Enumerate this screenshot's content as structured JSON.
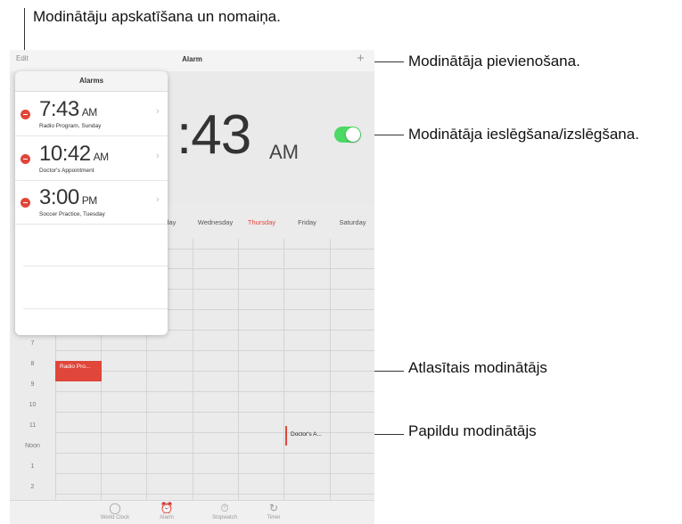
{
  "callouts": {
    "top": "Modinātāju apskatīšana un nomaiņa.",
    "add": "Modinātāja pievienošana.",
    "toggle": "Modinātāja ieslēgšana/izslēgšana.",
    "selected": "Atlasītais modinātājs",
    "additional": "Papildu modinātājs"
  },
  "navbar": {
    "edit": "Edit",
    "title": "Alarm",
    "add_glyph": "+"
  },
  "clock": {
    "time": ":43",
    "ampm": "AM"
  },
  "toggle": {
    "on": true
  },
  "popover": {
    "title": "Alarms",
    "alarms": [
      {
        "time": "7:43",
        "ampm": "AM",
        "label": "Radio Program, Sunday"
      },
      {
        "time": "10:42",
        "ampm": "AM",
        "label": "Doctor's Appointment"
      },
      {
        "time": "3:00",
        "ampm": "PM",
        "label": "Soccer Practice, Tuesday"
      }
    ]
  },
  "calendar": {
    "days": [
      "Tuesday",
      "Wednesday",
      "Thursday",
      "Friday",
      "Saturday"
    ],
    "days_visible": [
      "sday",
      "Wednesday",
      "Thursday",
      "Friday",
      "Saturday"
    ],
    "today": "Thursday",
    "hours": [
      "7",
      "8",
      "9",
      "10",
      "11",
      "Noon",
      "1",
      "2"
    ],
    "events": [
      {
        "label": "Radio Pro...",
        "day": "Sunday",
        "hour": "8"
      },
      {
        "label": "Doctor's A...",
        "day": "Friday",
        "hour": "11"
      }
    ]
  },
  "tabbar": {
    "tabs": [
      {
        "label": "World Clock",
        "icon": "globe-icon"
      },
      {
        "label": "Alarm",
        "icon": "alarm-clock-icon"
      },
      {
        "label": "Stopwatch",
        "icon": "stopwatch-icon"
      },
      {
        "label": "Timer",
        "icon": "timer-icon"
      }
    ]
  },
  "colors": {
    "accent": "#e0463a",
    "toggle_on": "#4cd964"
  }
}
